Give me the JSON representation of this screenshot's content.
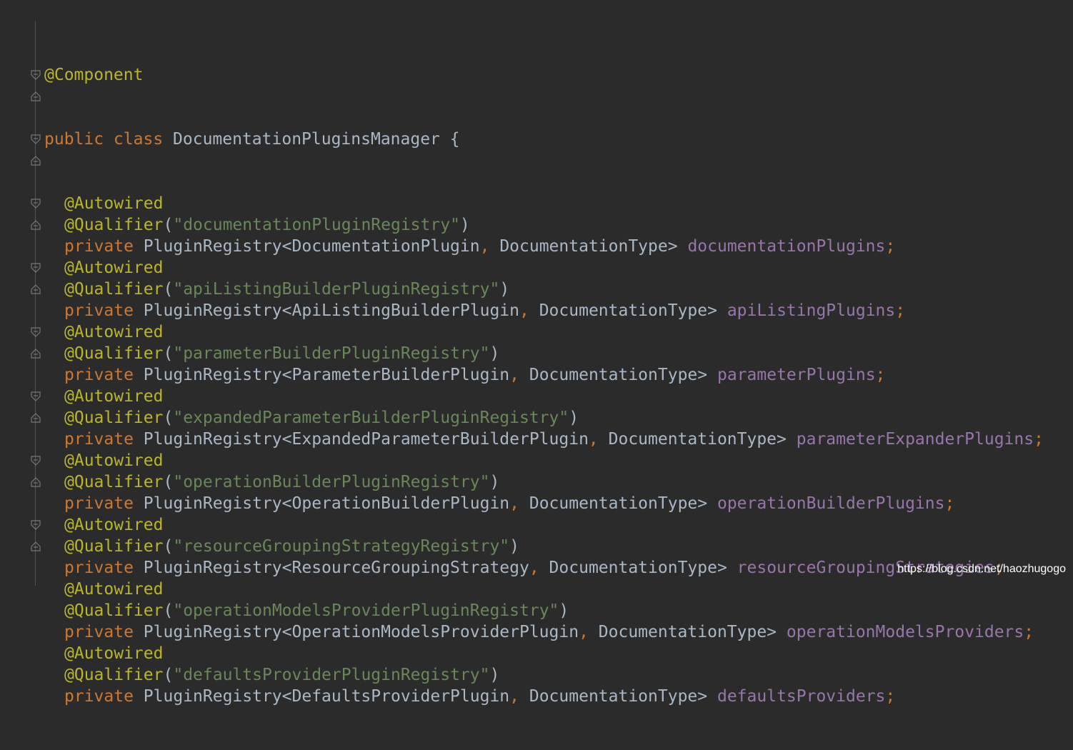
{
  "code": {
    "class_annotation": "@Component",
    "class_modifiers": "public class",
    "class_name": "DocumentationPluginsManager",
    "class_open_brace": "{",
    "autowired": "@Autowired",
    "qualifier": "@Qualifier",
    "private_kw": "private",
    "fields": [
      {
        "registry": "\"documentationPluginRegistry\"",
        "type_prefix": "PluginRegistry<DocumentationPlugin",
        "type_suffix": " DocumentationType>",
        "name": "documentationPlugins"
      },
      {
        "registry": "\"apiListingBuilderPluginRegistry\"",
        "type_prefix": "PluginRegistry<ApiListingBuilderPlugin",
        "type_suffix": " DocumentationType>",
        "name": "apiListingPlugins"
      },
      {
        "registry": "\"parameterBuilderPluginRegistry\"",
        "type_prefix": "PluginRegistry<ParameterBuilderPlugin",
        "type_suffix": " DocumentationType>",
        "name": "parameterPlugins"
      },
      {
        "registry": "\"expandedParameterBuilderPluginRegistry\"",
        "type_prefix": "PluginRegistry<ExpandedParameterBuilderPlugin",
        "type_suffix": " DocumentationType>",
        "name": "parameterExpanderPlugins"
      },
      {
        "registry": "\"operationBuilderPluginRegistry\"",
        "type_prefix": "PluginRegistry<OperationBuilderPlugin",
        "type_suffix": " DocumentationType>",
        "name": "operationBuilderPlugins"
      },
      {
        "registry": "\"resourceGroupingStrategyRegistry\"",
        "type_prefix": "PluginRegistry<ResourceGroupingStrategy",
        "type_suffix": " DocumentationType>",
        "name": "resourceGroupingStrategies"
      },
      {
        "registry": "\"operationModelsProviderPluginRegistry\"",
        "type_prefix": "PluginRegistry<OperationModelsProviderPlugin",
        "type_suffix": " DocumentationType>",
        "name": "operationModelsProviders"
      },
      {
        "registry": "\"defaultsProviderPluginRegistry\"",
        "type_prefix": "PluginRegistry<DefaultsProviderPlugin",
        "type_suffix": " DocumentationType>",
        "name": "defaultsProviders"
      }
    ]
  },
  "watermark": "https://blog.csdn.net/haozhugogo",
  "colors": {
    "background": "#2b2b2b",
    "annotation": "#bbb529",
    "keyword": "#cc7832",
    "string": "#6a8759",
    "field": "#9876aa",
    "text": "#a9b7c6"
  }
}
